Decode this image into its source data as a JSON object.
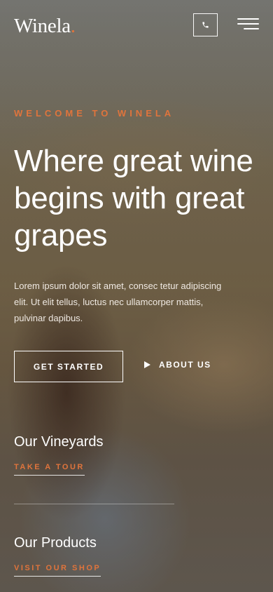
{
  "header": {
    "logo_text": "Winela",
    "logo_dot": ".",
    "phone_icon": "phone-icon",
    "menu_icon": "hamburger-menu-icon"
  },
  "hero": {
    "eyebrow": "WELCOME TO WINELA",
    "headline": "Where great wine begins with great grapes",
    "intro": "Lorem ipsum dolor sit amet, consec tetur adipiscing elit. Ut elit tellus, luctus nec ullamcorper mattis, pulvinar dapibus.",
    "primary_cta": "GET STARTED",
    "secondary_cta": "ABOUT US",
    "secondary_cta_icon": "play-icon"
  },
  "sections": [
    {
      "title": "Our Vineyards",
      "link": "TAKE A TOUR"
    },
    {
      "title": "Our Products",
      "link": "VISIT OUR SHOP"
    }
  ],
  "colors": {
    "accent": "#e0743c",
    "text": "#ffffff"
  }
}
